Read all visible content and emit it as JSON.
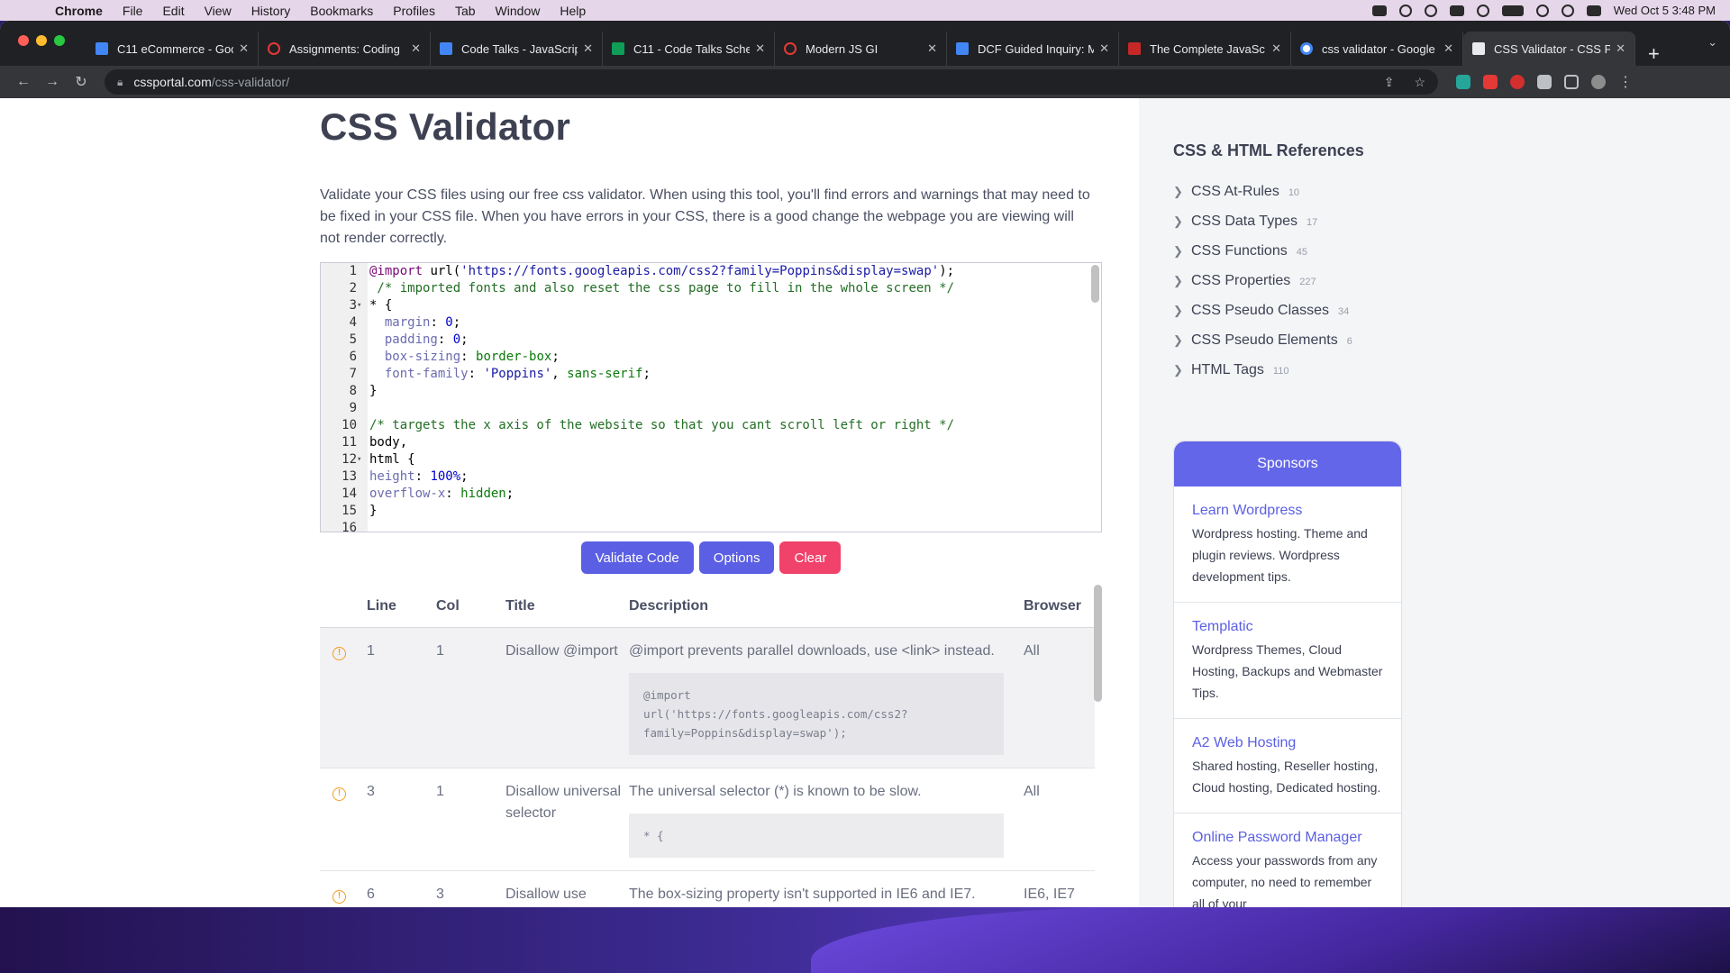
{
  "menubar": {
    "app": "Chrome",
    "items": [
      "File",
      "Edit",
      "View",
      "History",
      "Bookmarks",
      "Profiles",
      "Tab",
      "Window",
      "Help"
    ],
    "datetime": "Wed Oct 5  3:48 PM"
  },
  "tabs": [
    {
      "label": "C11 eCommerce - Goo",
      "favicon": "doc-icon",
      "active": false
    },
    {
      "label": "Assignments: Coding",
      "favicon": "ring-icon",
      "active": false
    },
    {
      "label": "Code Talks - JavaScrip",
      "favicon": "doc-icon",
      "active": false
    },
    {
      "label": "C11 - Code Talks Sche",
      "favicon": "sheet-icon",
      "active": false
    },
    {
      "label": "Modern JS GI",
      "favicon": "ring-icon",
      "active": false
    },
    {
      "label": "DCF Guided Inquiry: M",
      "favicon": "doc-icon",
      "active": false
    },
    {
      "label": "The Complete JavaSc",
      "favicon": "book-icon",
      "active": false
    },
    {
      "label": "css validator - Google",
      "favicon": "google-icon",
      "active": false
    },
    {
      "label": "CSS Validator - CSS P",
      "favicon": "css-icon",
      "active": true
    }
  ],
  "address": {
    "domain": "cssportal.com",
    "path": "/css-validator/"
  },
  "page": {
    "title": "CSS Validator",
    "intro": "Validate your CSS files using our free css validator. When using this tool, you'll find errors and warnings that may need to be fixed in your CSS file. When you have errors in your CSS, there is a good change the webpage you are viewing will not render correctly."
  },
  "editor": {
    "lines": [
      {
        "n": "1",
        "fold": "",
        "parts": [
          [
            "kw",
            "@import"
          ],
          [
            "",
            " url("
          ],
          [
            "str",
            "'https://fonts.googleapis.com/css2?family=Poppins&display=swap'"
          ],
          [
            "",
            ");"
          ]
        ]
      },
      {
        "n": "2",
        "fold": "",
        "parts": [
          [
            "com",
            " /* imported fonts and also reset the css page to fill in the whole screen */"
          ]
        ]
      },
      {
        "n": "3",
        "fold": "▾",
        "parts": [
          [
            "",
            "* {"
          ]
        ]
      },
      {
        "n": "4",
        "fold": "",
        "parts": [
          [
            "",
            "  "
          ],
          [
            "prop",
            "margin"
          ],
          [
            "",
            ": "
          ],
          [
            "num",
            "0"
          ],
          [
            "",
            ";"
          ]
        ]
      },
      {
        "n": "5",
        "fold": "",
        "parts": [
          [
            "",
            "  "
          ],
          [
            "prop",
            "padding"
          ],
          [
            "",
            ": "
          ],
          [
            "num",
            "0"
          ],
          [
            "",
            ";"
          ]
        ]
      },
      {
        "n": "6",
        "fold": "",
        "parts": [
          [
            "",
            "  "
          ],
          [
            "prop",
            "box-sizing"
          ],
          [
            "",
            ": "
          ],
          [
            "val",
            "border-box"
          ],
          [
            "",
            ";"
          ]
        ]
      },
      {
        "n": "7",
        "fold": "",
        "parts": [
          [
            "",
            "  "
          ],
          [
            "prop",
            "font-family"
          ],
          [
            "",
            ": "
          ],
          [
            "str",
            "'Poppins'"
          ],
          [
            "",
            ", "
          ],
          [
            "val",
            "sans-serif"
          ],
          [
            "",
            ";"
          ]
        ]
      },
      {
        "n": "8",
        "fold": "",
        "parts": [
          [
            "",
            "}"
          ]
        ]
      },
      {
        "n": "9",
        "fold": "",
        "parts": [
          [
            "",
            ""
          ]
        ]
      },
      {
        "n": "10",
        "fold": "",
        "parts": [
          [
            "com",
            "/* targets the x axis of the website so that you cant scroll left or right */"
          ]
        ]
      },
      {
        "n": "11",
        "fold": "",
        "parts": [
          [
            "",
            "body,"
          ]
        ]
      },
      {
        "n": "12",
        "fold": "▾",
        "parts": [
          [
            "",
            "html {"
          ]
        ]
      },
      {
        "n": "13",
        "fold": "",
        "parts": [
          [
            "prop",
            "height"
          ],
          [
            "",
            ": "
          ],
          [
            "num",
            "100%"
          ],
          [
            "",
            ";"
          ]
        ]
      },
      {
        "n": "14",
        "fold": "",
        "parts": [
          [
            "prop",
            "overflow-x"
          ],
          [
            "",
            ": "
          ],
          [
            "val",
            "hidden"
          ],
          [
            "",
            ";"
          ]
        ]
      },
      {
        "n": "15",
        "fold": "",
        "parts": [
          [
            "",
            "}"
          ]
        ]
      },
      {
        "n": "16",
        "fold": "",
        "parts": [
          [
            "",
            ""
          ]
        ]
      }
    ]
  },
  "buttons": {
    "validate": "Validate Code",
    "options": "Options",
    "clear": "Clear"
  },
  "results": {
    "headers": {
      "line": "Line",
      "col": "Col",
      "title": "Title",
      "description": "Description",
      "browser": "Browser"
    },
    "rows": [
      {
        "line": "1",
        "col": "1",
        "title": "Disallow @import",
        "description": "@import prevents parallel downloads, use <link> instead.",
        "snippet": "@import\nurl('https://fonts.googleapis.com/css2?\nfamily=Poppins&display=swap');",
        "browser": "All"
      },
      {
        "line": "3",
        "col": "1",
        "title": "Disallow universal selector",
        "description": "The universal selector (*) is known to be slow.",
        "snippet": "* {",
        "browser": "All"
      },
      {
        "line": "6",
        "col": "3",
        "title": "Disallow use",
        "description": "The box-sizing property isn't supported in IE6 and IE7.",
        "snippet": "",
        "browser": "IE6, IE7"
      }
    ]
  },
  "sidebar": {
    "title": "CSS & HTML References",
    "refs": [
      {
        "label": "CSS At-Rules",
        "count": "10"
      },
      {
        "label": "CSS Data Types",
        "count": "17"
      },
      {
        "label": "CSS Functions",
        "count": "45"
      },
      {
        "label": "CSS Properties",
        "count": "227"
      },
      {
        "label": "CSS Pseudo Classes",
        "count": "34"
      },
      {
        "label": "CSS Pseudo Elements",
        "count": "6"
      },
      {
        "label": "HTML Tags",
        "count": "110"
      }
    ],
    "sponsors_title": "Sponsors",
    "sponsors": [
      {
        "name": "Learn Wordpress",
        "desc": "Wordpress hosting. Theme and plugin reviews. Wordpress development tips."
      },
      {
        "name": "Templatic",
        "desc": "Wordpress Themes, Cloud Hosting, Backups and Webmaster Tips."
      },
      {
        "name": "A2 Web Hosting",
        "desc": "Shared hosting, Reseller hosting, Cloud hosting, Dedicated hosting."
      },
      {
        "name": "Online Password Manager",
        "desc": "Access your passwords from any computer, no need to remember all of your"
      }
    ]
  },
  "colors": {
    "accent": "#5b5fe3",
    "danger": "#f0426a",
    "warning": "#f29c1f",
    "sponsor_header": "#6366e8"
  }
}
